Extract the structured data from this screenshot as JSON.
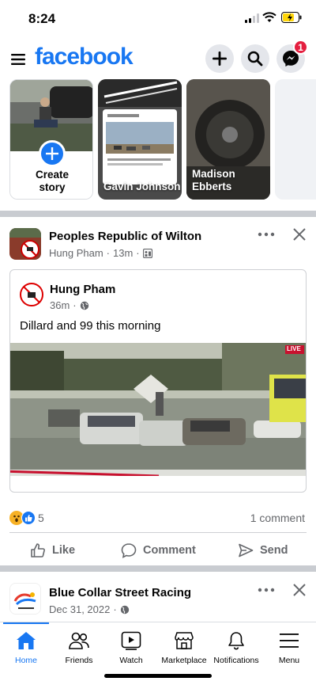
{
  "status_bar": {
    "time": "8:24"
  },
  "header": {
    "logo": "facebook",
    "messenger_badge": "1"
  },
  "stories": {
    "create_label_line1": "Create",
    "create_label_line2": "story",
    "items": [
      {
        "name": "Gavin Johnson"
      },
      {
        "name_line1": "Madison",
        "name_line2": "Ebberts"
      }
    ]
  },
  "post": {
    "group_name": "Peoples Republic of Wilton",
    "author": "Hung Pham",
    "time": "13m",
    "shared": {
      "author": "Hung Pham",
      "time": "36m",
      "text": "Dillard and 99 this morning",
      "live_badge": "LIVE"
    },
    "reaction_count": "5",
    "comment_count": "1 comment",
    "actions": {
      "like": "Like",
      "comment": "Comment",
      "send": "Send"
    }
  },
  "next_post": {
    "group_name": "Blue Collar Street Racing",
    "date": "Dec 31, 2022"
  },
  "bottom_nav": [
    {
      "label": "Home",
      "active": true
    },
    {
      "label": "Friends"
    },
    {
      "label": "Watch"
    },
    {
      "label": "Marketplace"
    },
    {
      "label": "Notifications"
    },
    {
      "label": "Menu"
    }
  ],
  "colors": {
    "brand": "#1877f2",
    "secondary_text": "#65676b",
    "badge": "#e41e3f"
  }
}
